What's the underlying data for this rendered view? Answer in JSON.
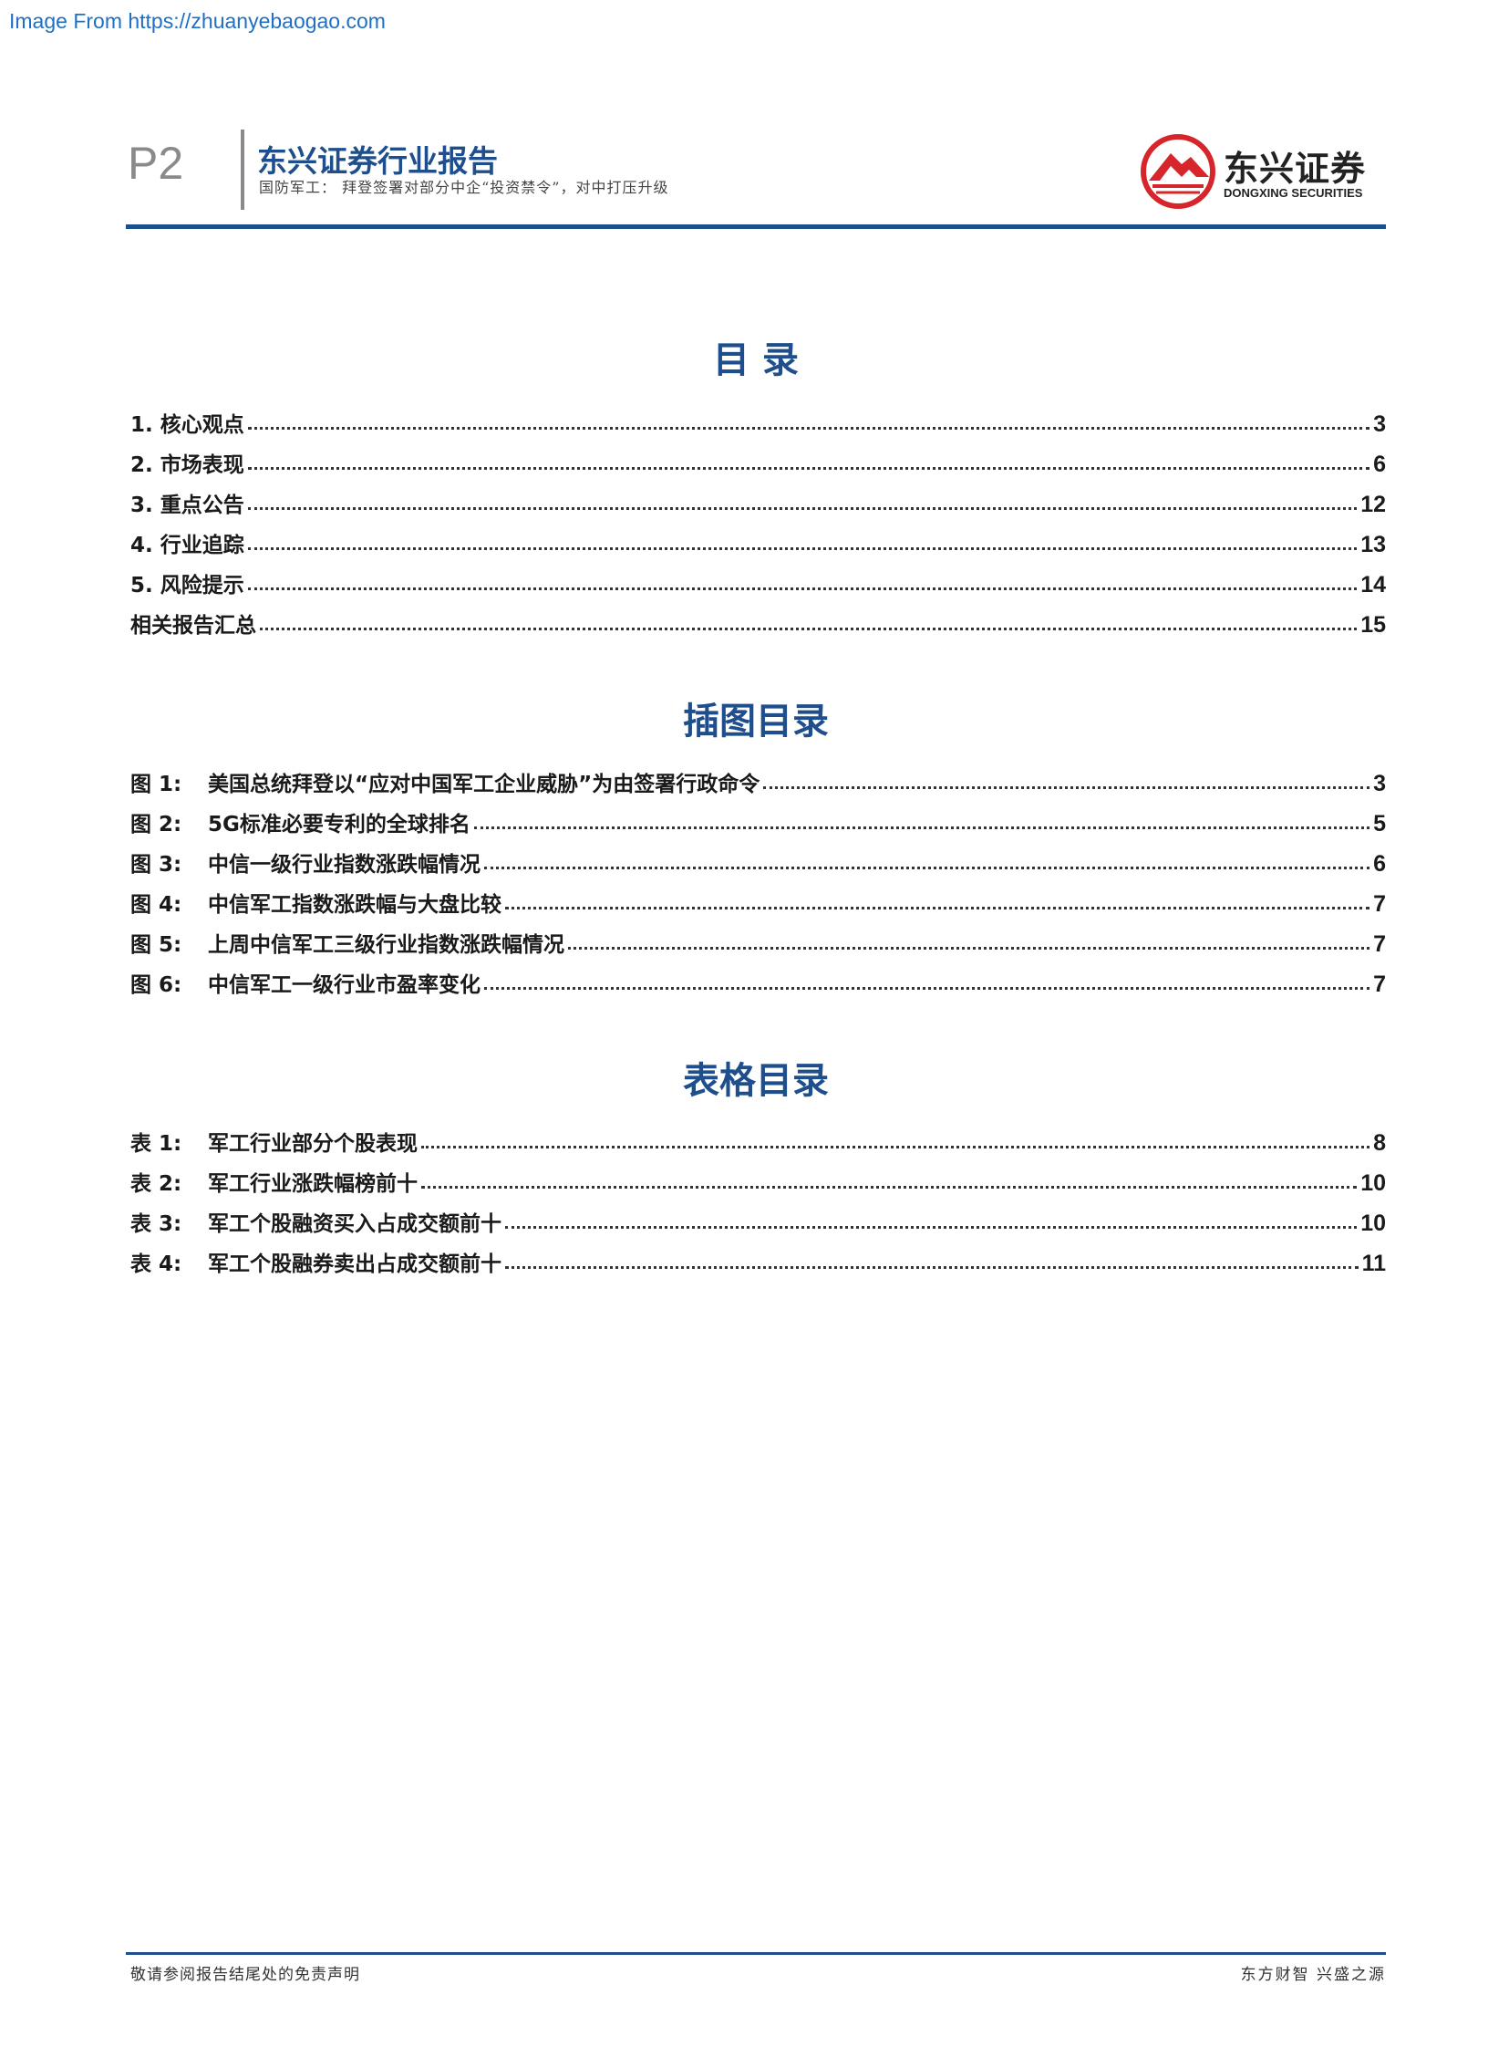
{
  "watermark": "Image From https://zhuanyebaogao.com",
  "header": {
    "page_number": "P2",
    "title": "东兴证券行业报告",
    "subtitle": "国防军工：  拜登签署对部分中企“投资禁令”，对中打压升级",
    "logo_cn": "东兴证券",
    "logo_en": "DONGXING SECURITIES",
    "colors": {
      "brand_blue": "#1f4e8c",
      "logo_red": "#d7262b"
    }
  },
  "toc": {
    "title": "目   录",
    "items": [
      {
        "label": "1. 核心观点",
        "page": "3"
      },
      {
        "label": "2. 市场表现",
        "page": "6"
      },
      {
        "label": "3. 重点公告",
        "page": "12"
      },
      {
        "label": "4. 行业追踪",
        "page": "13"
      },
      {
        "label": "5. 风险提示",
        "page": "14"
      },
      {
        "label": "相关报告汇总",
        "page": "15"
      }
    ]
  },
  "figures": {
    "title": "插图目录",
    "items": [
      {
        "prefix": "图 1:",
        "label": "美国总统拜登以“应对中国军工企业威胁”为由签署行政命令",
        "page": "3"
      },
      {
        "prefix": "图 2:",
        "label": "5G标准必要专利的全球排名",
        "page": "5"
      },
      {
        "prefix": "图 3:",
        "label": "中信一级行业指数涨跌幅情况",
        "page": "6"
      },
      {
        "prefix": "图 4:",
        "label": "中信军工指数涨跌幅与大盘比较",
        "page": "7"
      },
      {
        "prefix": "图 5:",
        "label": "上周中信军工三级行业指数涨跌幅情况",
        "page": "7"
      },
      {
        "prefix": "图 6:",
        "label": "中信军工一级行业市盈率变化",
        "page": "7"
      }
    ]
  },
  "tables": {
    "title": "表格目录",
    "items": [
      {
        "prefix": "表 1:",
        "label": "军工行业部分个股表现",
        "page": "8"
      },
      {
        "prefix": "表 2:",
        "label": "军工行业涨跌幅榜前十",
        "page": "10"
      },
      {
        "prefix": "表 3:",
        "label": "军工个股融资买入占成交额前十",
        "page": "10"
      },
      {
        "prefix": "表 4:",
        "label": "军工个股融券卖出占成交额前十",
        "page": "11"
      }
    ]
  },
  "footer": {
    "left": "敬请参阅报告结尾处的免责声明",
    "right": "东方财智 兴盛之源"
  }
}
